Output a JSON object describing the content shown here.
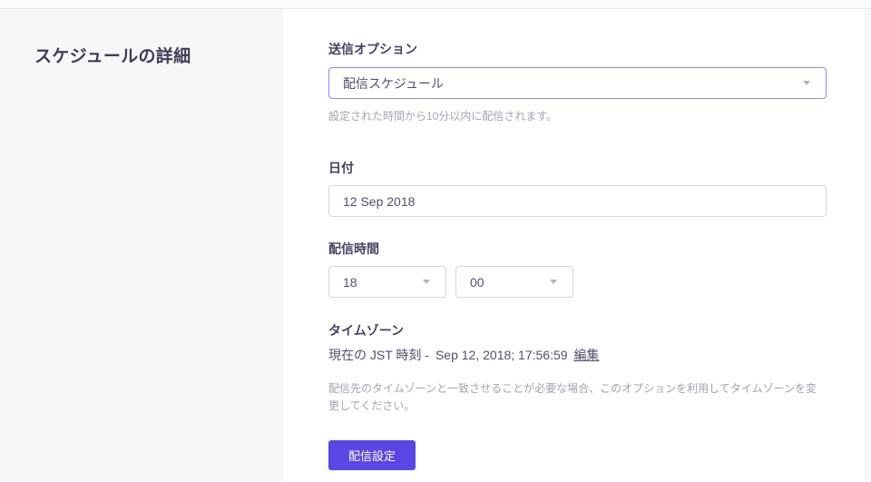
{
  "colors": {
    "accent": "#5a46e4",
    "select_accent_border": "#9184ef",
    "sidebar_bg": "#f7f7f8",
    "input_border": "#d6d6dc",
    "heading": "#3e3c58",
    "label": "#454361",
    "text": "#514f6e",
    "help": "#a3a3ad",
    "caret": "#b4b4bc",
    "topstrip_bg": "#fbfbfc",
    "topstrip_border": "#e9e9ed",
    "button_text": "#ffffff"
  },
  "sidebar": {
    "title": "スケジュールの詳細"
  },
  "form": {
    "send_option": {
      "label": "送信オプション",
      "value": "配信スケジュール",
      "help": "設定された時間から10分以内に配信されます。"
    },
    "date": {
      "label": "日付",
      "value": "12 Sep 2018"
    },
    "time": {
      "label": "配信時間",
      "hour": "18",
      "minute": "00"
    },
    "timezone": {
      "label": "タイムゾーン",
      "current_prefix": "現在の JST 時刻 -",
      "current_time": "Sep 12, 2018; 17:56:59",
      "edit_link": "編集",
      "help": "配信先のタイムゾーンと一致させることが必要な場合、このオプションを利用してタイムゾーンを変更してください。"
    },
    "submit_label": "配信設定"
  }
}
